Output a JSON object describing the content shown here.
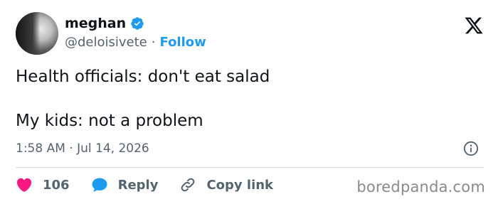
{
  "author": {
    "name": "meghan",
    "handle": "@deloisivete",
    "separator": "·",
    "follow_label": "Follow"
  },
  "tweet": {
    "line1": "Health officials: don't eat salad",
    "line2": "My kids: not a problem",
    "timestamp": "1:58 AM · Jul 14, 2026"
  },
  "actions": {
    "likes": "106",
    "reply_label": "Reply",
    "copy_label": "Copy link"
  },
  "watermark": "boredpanda.com",
  "icons": {
    "verified": "verified-badge-icon",
    "x_logo": "x-logo-icon",
    "info": "info-icon",
    "heart": "heart-icon",
    "reply": "reply-bubble-icon",
    "link": "link-icon"
  },
  "colors": {
    "verified": "#1d9bf0",
    "follow": "#1d9bf0",
    "heart": "#f91880",
    "reply": "#1d9bf0",
    "secondary_text": "#536471",
    "primary_text": "#0f1419"
  }
}
